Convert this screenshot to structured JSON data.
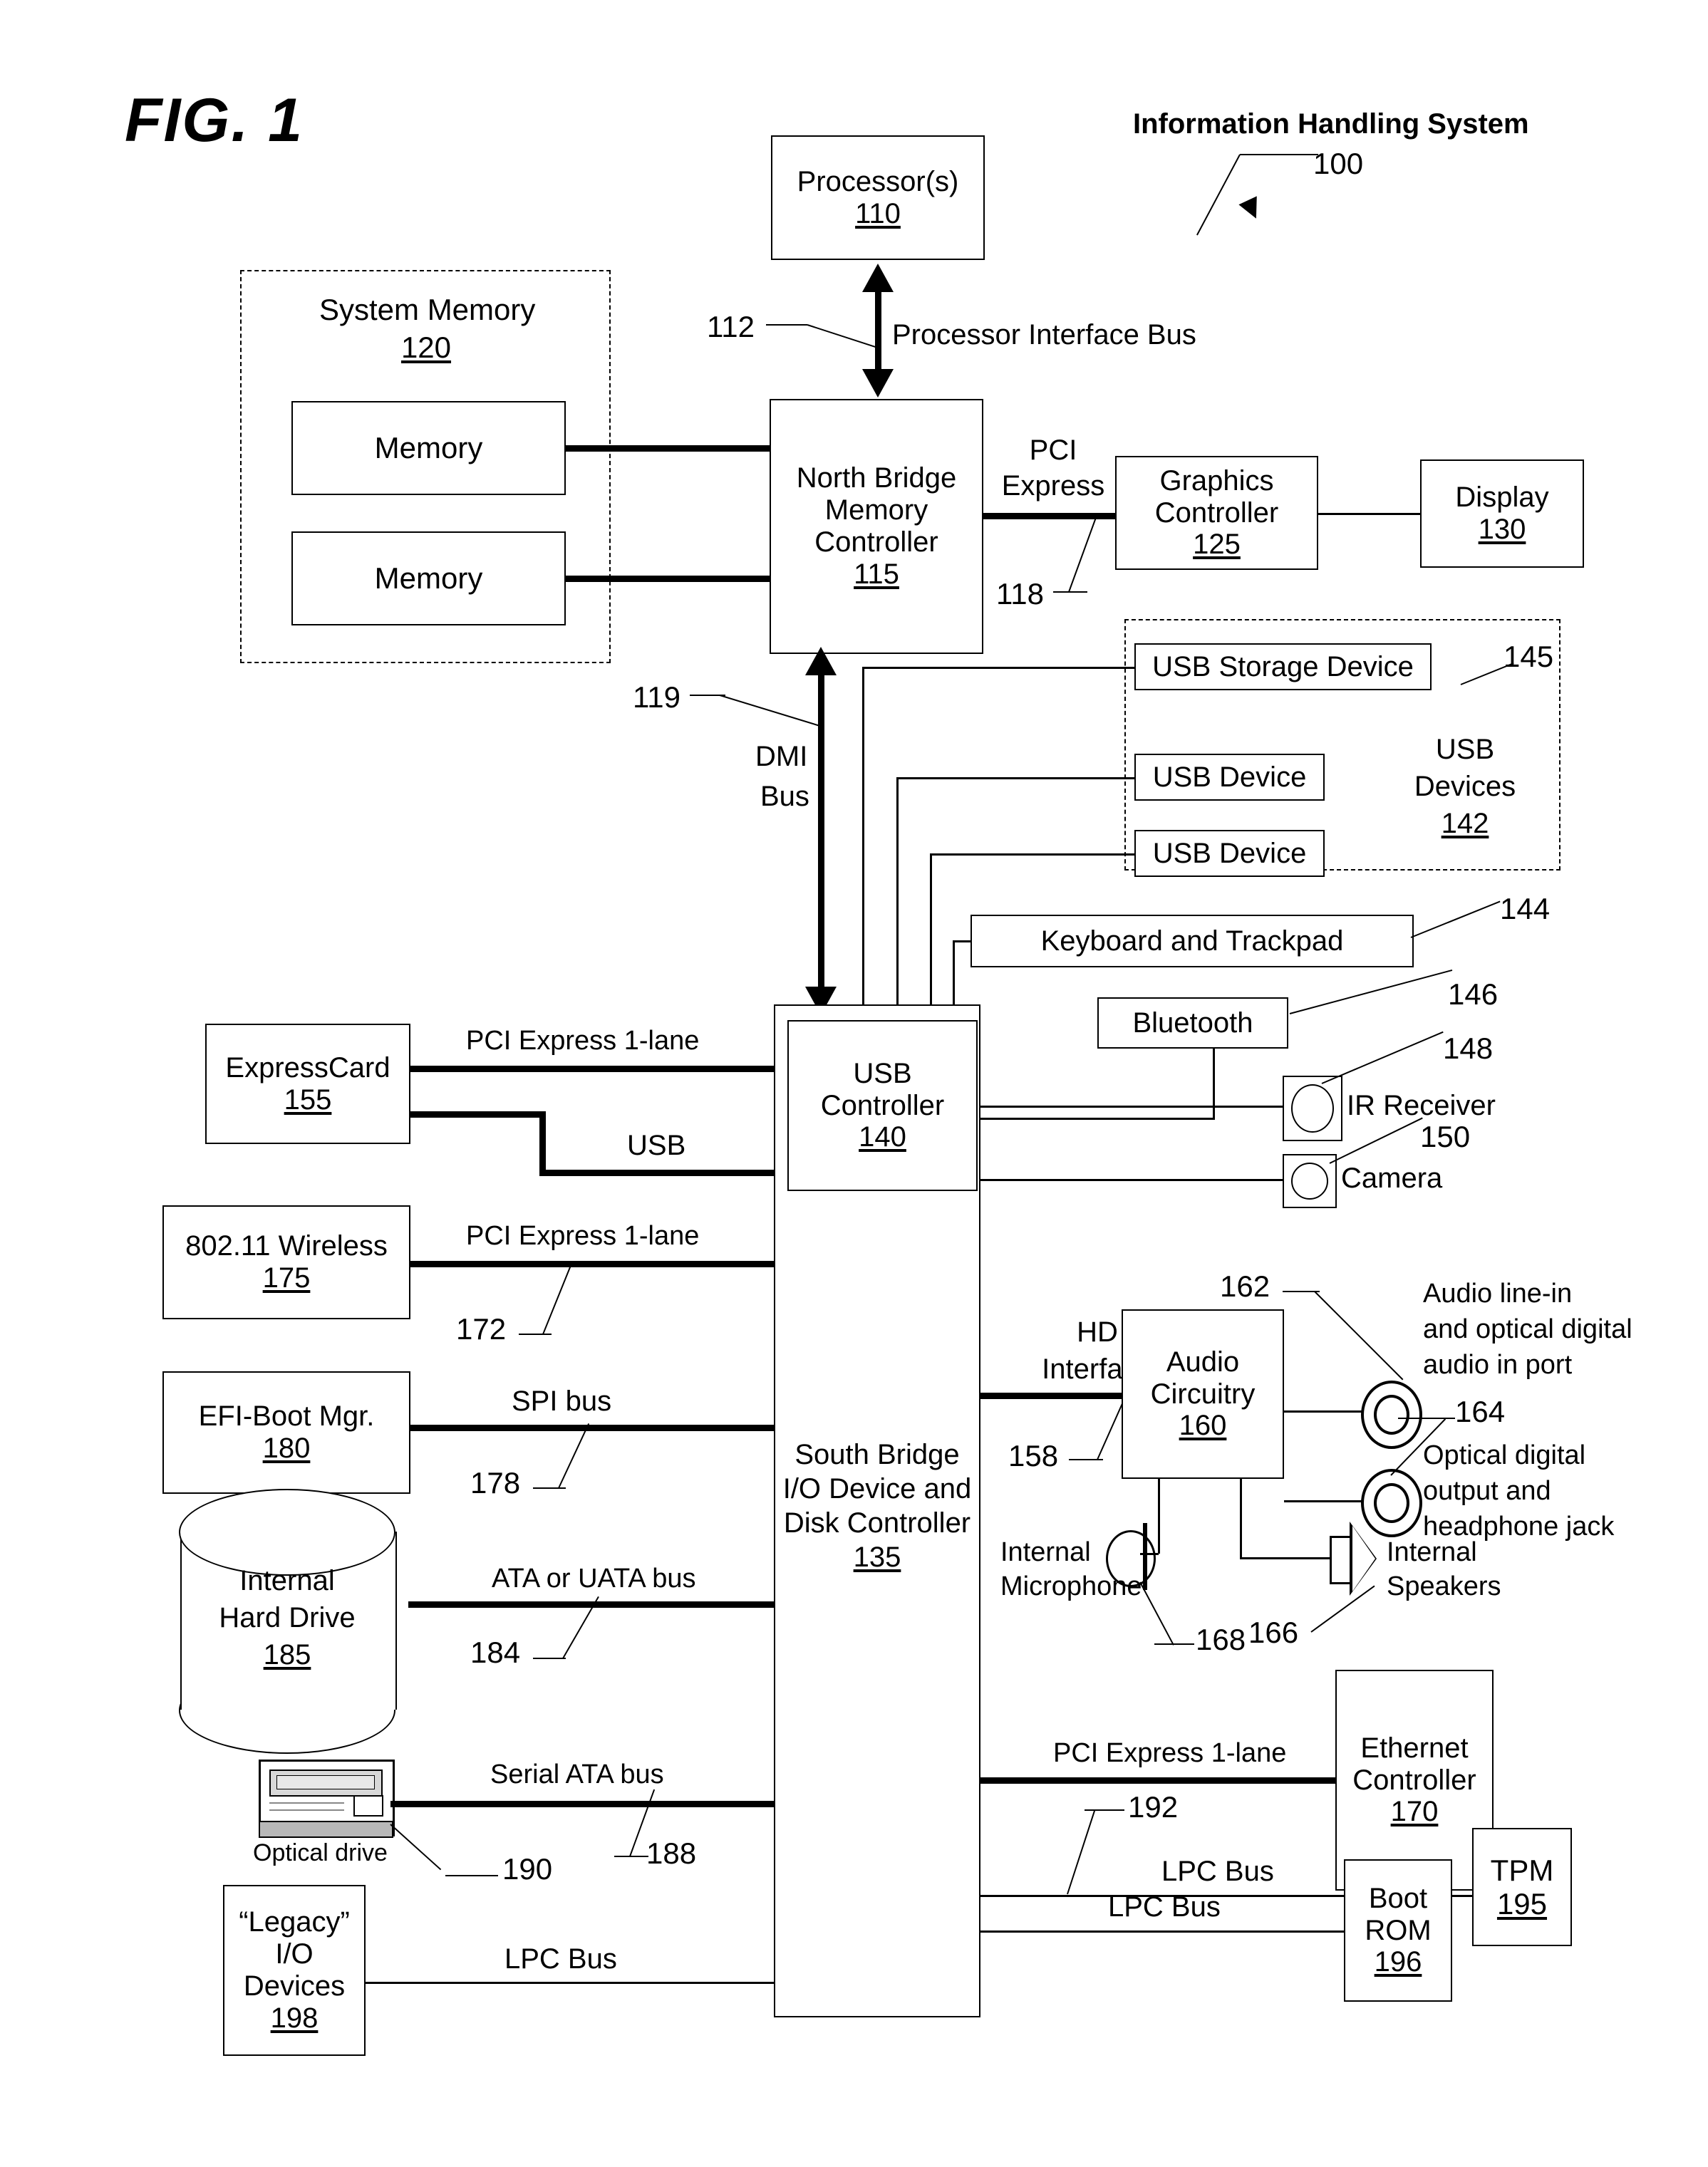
{
  "figure": {
    "label": "FIG. 1",
    "system_title": "Information Handling System",
    "system_ref": "100"
  },
  "blocks": {
    "processor": {
      "lines": [
        "Processor(s)"
      ],
      "ref": "110"
    },
    "system_memory": {
      "title": "System Memory",
      "ref": "120"
    },
    "memory_a": {
      "label": "Memory"
    },
    "memory_b": {
      "label": "Memory"
    },
    "north_bridge": {
      "lines": [
        "North Bridge",
        "Memory",
        "Controller"
      ],
      "ref": "115"
    },
    "graphics": {
      "lines": [
        "Graphics",
        "Controller"
      ],
      "ref": "125"
    },
    "display": {
      "lines": [
        "Display"
      ],
      "ref": "130"
    },
    "usb_storage": {
      "label": "USB Storage Device",
      "ref": "145"
    },
    "usb_device_1": {
      "label": "USB Device"
    },
    "usb_device_2": {
      "label": "USB Device"
    },
    "usb_devices_group": {
      "lines": [
        "USB",
        "Devices"
      ],
      "ref": "142"
    },
    "keyboard": {
      "label": "Keyboard and Trackpad",
      "ref": "144"
    },
    "bluetooth": {
      "label": "Bluetooth",
      "ref": "146"
    },
    "ir_receiver": {
      "label": "IR Receiver",
      "ref": "148"
    },
    "camera": {
      "label": "Camera",
      "ref": "150"
    },
    "usb_controller": {
      "lines": [
        "USB",
        "Controller"
      ],
      "ref": "140"
    },
    "south_bridge": {
      "lines": [
        "South Bridge",
        "I/O Device and",
        "Disk Controller"
      ],
      "ref": "135"
    },
    "expresscard": {
      "lines": [
        "ExpressCard"
      ],
      "ref": "155"
    },
    "wireless": {
      "lines": [
        "802.11 Wireless"
      ],
      "ref": "175"
    },
    "efi_boot_mgr": {
      "lines": [
        "EFI-Boot Mgr."
      ],
      "ref": "180"
    },
    "hard_drive": {
      "lines": [
        "Internal",
        "Hard Drive"
      ],
      "ref": "185"
    },
    "optical_drive": {
      "label": "Optical drive",
      "ref": "190"
    },
    "legacy_io": {
      "lines": [
        "“Legacy”",
        "I/O",
        "Devices"
      ],
      "ref": "198"
    },
    "audio_circuitry": {
      "lines": [
        "Audio",
        "Circuitry"
      ],
      "ref": "160"
    },
    "audio_line_in": {
      "lines": [
        "Audio line-in",
        "and optical digital",
        "audio in port"
      ],
      "ref": "162"
    },
    "optical_out": {
      "lines": [
        "Optical digital",
        "output and",
        "headphone jack"
      ],
      "ref": "164"
    },
    "internal_mic": {
      "lines": [
        "Internal",
        "Microphone"
      ],
      "ref": "168"
    },
    "internal_speakers": {
      "lines": [
        "Internal",
        "Speakers"
      ],
      "ref": "166"
    },
    "ethernet": {
      "lines": [
        "Ethernet",
        "Controller"
      ],
      "ref": "170"
    },
    "tpm": {
      "lines": [
        "TPM"
      ],
      "ref": "195"
    },
    "boot_rom": {
      "lines": [
        "Boot",
        "ROM"
      ],
      "ref": "196"
    }
  },
  "buses": {
    "processor_interface": {
      "label": "Processor Interface Bus",
      "ref": "112"
    },
    "pci_express_graphics": {
      "line1": "PCI",
      "line2": "Express",
      "ref": "118"
    },
    "dmi": {
      "line1": "DMI",
      "line2": "Bus",
      "ref": "119"
    },
    "pcie_expresscard": {
      "label": "PCI Express 1-lane"
    },
    "usb_expresscard": {
      "label": "USB"
    },
    "pcie_wireless": {
      "label": "PCI Express 1-lane",
      "ref": "172"
    },
    "spi": {
      "label": "SPI bus",
      "ref": "178"
    },
    "ata": {
      "label": "ATA or UATA bus",
      "ref": "184"
    },
    "sata": {
      "label": "Serial ATA bus",
      "ref": "188"
    },
    "lpc_legacy": {
      "label": "LPC Bus"
    },
    "hd_interface": {
      "line1": "HD",
      "line2": "Interface",
      "ref": "158"
    },
    "pcie_ethernet": {
      "label": "PCI Express 1-lane"
    },
    "lpc_tpm": {
      "label": "LPC Bus",
      "ref": "192"
    },
    "lpc_bootrom": {
      "label": "LPC Bus"
    }
  },
  "colors": {
    "ink": "#000000",
    "paper": "#ffffff"
  }
}
